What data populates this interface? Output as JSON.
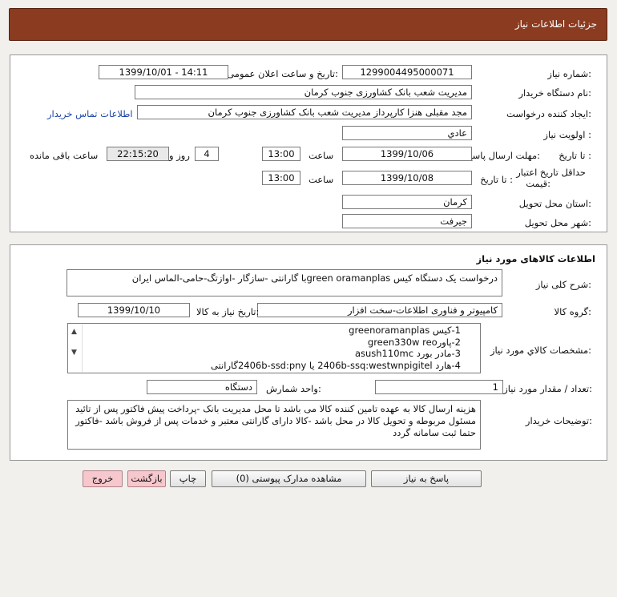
{
  "header": {
    "title": "جزئیات اطلاعات نیاز"
  },
  "info": {
    "need_number_label": "شماره نیاز:",
    "need_number": "1299004495000071",
    "announce_label": "تاریخ و ساعت اعلان عمومی:",
    "announce_value": "1399/10/01 - 14:11",
    "buyer_org_label": "نام دستگاه خریدار:",
    "buyer_org": "مدیریت شعب بانک کشاورزی جنوب کرمان",
    "requester_label": "ایجاد کننده درخواست:",
    "requester": "مجد مقبلی هنزا کارپرداز مدیریت شعب بانک کشاورزی جنوب کرمان",
    "contact_link": "اطلاعات تماس خریدار",
    "priority_label": "اولویت نیاز :",
    "priority": "عادي",
    "deadline_label": "مهلت ارسال پاسخ:",
    "to_date_label": "تا تاریخ :",
    "deadline_date": "1399/10/06",
    "time_label": "ساعت",
    "deadline_time": "13:00",
    "days_value": "4",
    "days_label": "روز و",
    "remaining_time": "22:15:20",
    "remaining_label": "ساعت باقی مانده",
    "validity_label_1": "حداقل تاریخ اعتبار",
    "validity_label_2": "قیمت:",
    "validity_date": "1399/10/08",
    "validity_time": "13:00",
    "province_label": "استان محل تحویل:",
    "province": "کرمان",
    "city_label": "شهر محل تحویل:",
    "city": "جیرفت"
  },
  "goods": {
    "section_title": "اطلاعات کالاهای مورد نیاز",
    "description_label": "شرح کلی نیاز:",
    "description": "درخواست یک دستگاه کیس green oramanplasبا گارانتی -سازگار -اوازتگ-حامی-الماس ایران",
    "group_label": "گروه کالا:",
    "group": "کامپیوتر و فناوری اطلاعات-سخت افزار",
    "need_date_label": "تاریخ نیاز به کالا:",
    "need_date": "1399/10/10",
    "specs_label": "مشخصات کالاي مورد نیاز:",
    "specs": [
      "1-کیس greenoramanplas",
      "2-پاورgreen330w reo",
      "3-مادر بورد asush110mc",
      "4-هارد 2406b-ssq:westwnpigitel یا 2406b-ssd:pnyگارانتی"
    ],
    "qty_label": "تعداد / مقدار مورد نیاز:",
    "qty": "1",
    "unit_label": "واحد شمارش:",
    "unit": "دستگاه",
    "buyer_notes_label": "توضیحات خریدار:",
    "buyer_notes": "هزینه ارسال کالا به عهده تامین کننده کالا می باشد تا محل مدیریت بانک -پرداخت پیش فاکتور پس از تائید مسئول مربوطه و تحویل کالا در محل باشد -کالا دارای گارانتی معتبر و خدمات پس از فروش باشد -فاکتور حتما ثبت سامانه گردد"
  },
  "actions": {
    "reply": "پاسخ به نیاز",
    "attachments": "مشاهده مدارک پیوستی (0)",
    "print": "چاپ",
    "back": "بازگشت",
    "exit": "خروج"
  }
}
